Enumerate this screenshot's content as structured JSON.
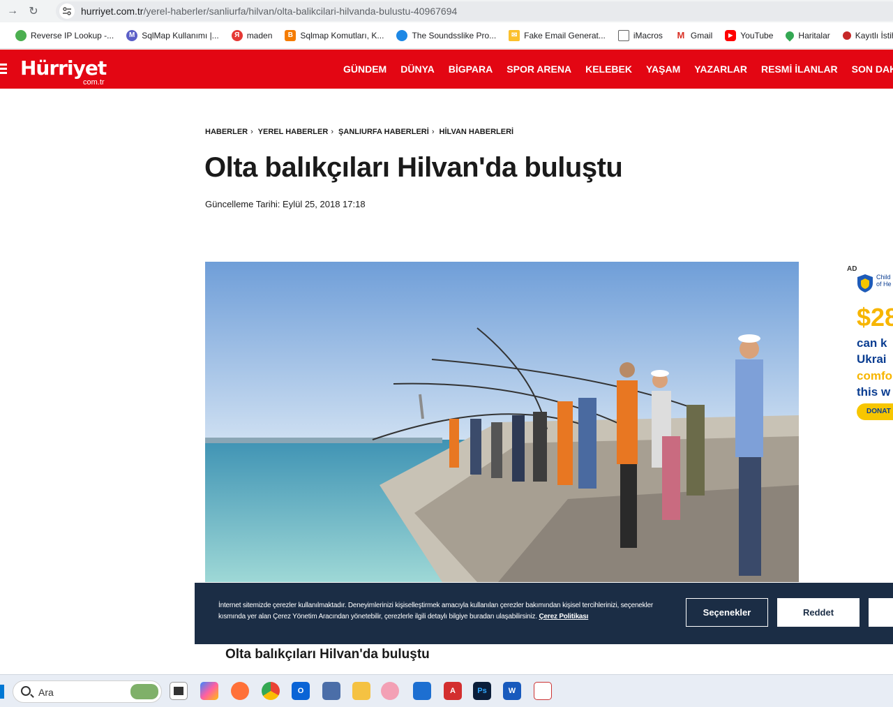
{
  "browser": {
    "url_domain": "hurriyet.com.tr",
    "url_path": "/yerel-haberler/sanliurfa/hilvan/olta-balikcilari-hilvanda-bulustu-40967694"
  },
  "bookmarks": [
    {
      "label": "Reverse IP Lookup -...",
      "color": "#4caf50"
    },
    {
      "label": "SqlMap Kullanımı |...",
      "color": "#5b5fc7"
    },
    {
      "label": "maden",
      "color": "#e53935"
    },
    {
      "label": "Sqlmap Komutları, K...",
      "color": "#f57c00"
    },
    {
      "label": "The Soundsslike Pro...",
      "color": "#1e88e5"
    },
    {
      "label": "Fake Email Generat...",
      "color": "#fbc02d"
    },
    {
      "label": "iMacros",
      "color": "#616161"
    },
    {
      "label": "Gmail",
      "color": "#d93025"
    },
    {
      "label": "YouTube",
      "color": "#ff0000"
    },
    {
      "label": "Haritalar",
      "color": "#34a853"
    },
    {
      "label": "Kayıtlı İstihdam Y",
      "color": "#c62828"
    }
  ],
  "site": {
    "logo": "Hürriyet",
    "logo_sub": "com.tr",
    "nav": [
      "GÜNDEM",
      "DÜNYA",
      "BİGPARA",
      "SPOR ARENA",
      "KELEBEK",
      "YAŞAM",
      "YAZARLAR",
      "RESMİ İLANLAR",
      "SON DAK"
    ],
    "brand_color": "#e30613"
  },
  "article": {
    "breadcrumb": [
      "HABERLER",
      "YEREL HABERLER",
      "ŞANLIURFA HABERLERİ",
      "HİLVAN HABERLERİ"
    ],
    "title": "Olta balıkçıları Hilvan'da buluştu",
    "updated": "Güncelleme Tarihi: Eylül 25, 2018 17:18",
    "caption": "Olta balıkçıları Hilvan'da buluştu"
  },
  "ad": {
    "label": "AD",
    "org_line1": "Child",
    "org_line2": "of He",
    "price": "$28",
    "lines": [
      "can k",
      "Ukrai",
      "comfo",
      "this w"
    ],
    "button": "DONAT"
  },
  "cookie": {
    "text": "İnternet sitemizde çerezler kullanılmaktadır. Deneyimlerinizi kişiselleştirmek amacıyla kullanılan çerezler bakımından kişisel tercihlerinizi, seçenekler kısmında yer alan Çerez Yönetim Aracından yönetebilir, çerezlerle ilgili detaylı bilgiye buradan ulaşabilirsiniz.",
    "link": "Çerez Politikası",
    "options": "Seçenekler",
    "reject": "Reddet"
  },
  "taskbar": {
    "search_placeholder": "Ara"
  }
}
